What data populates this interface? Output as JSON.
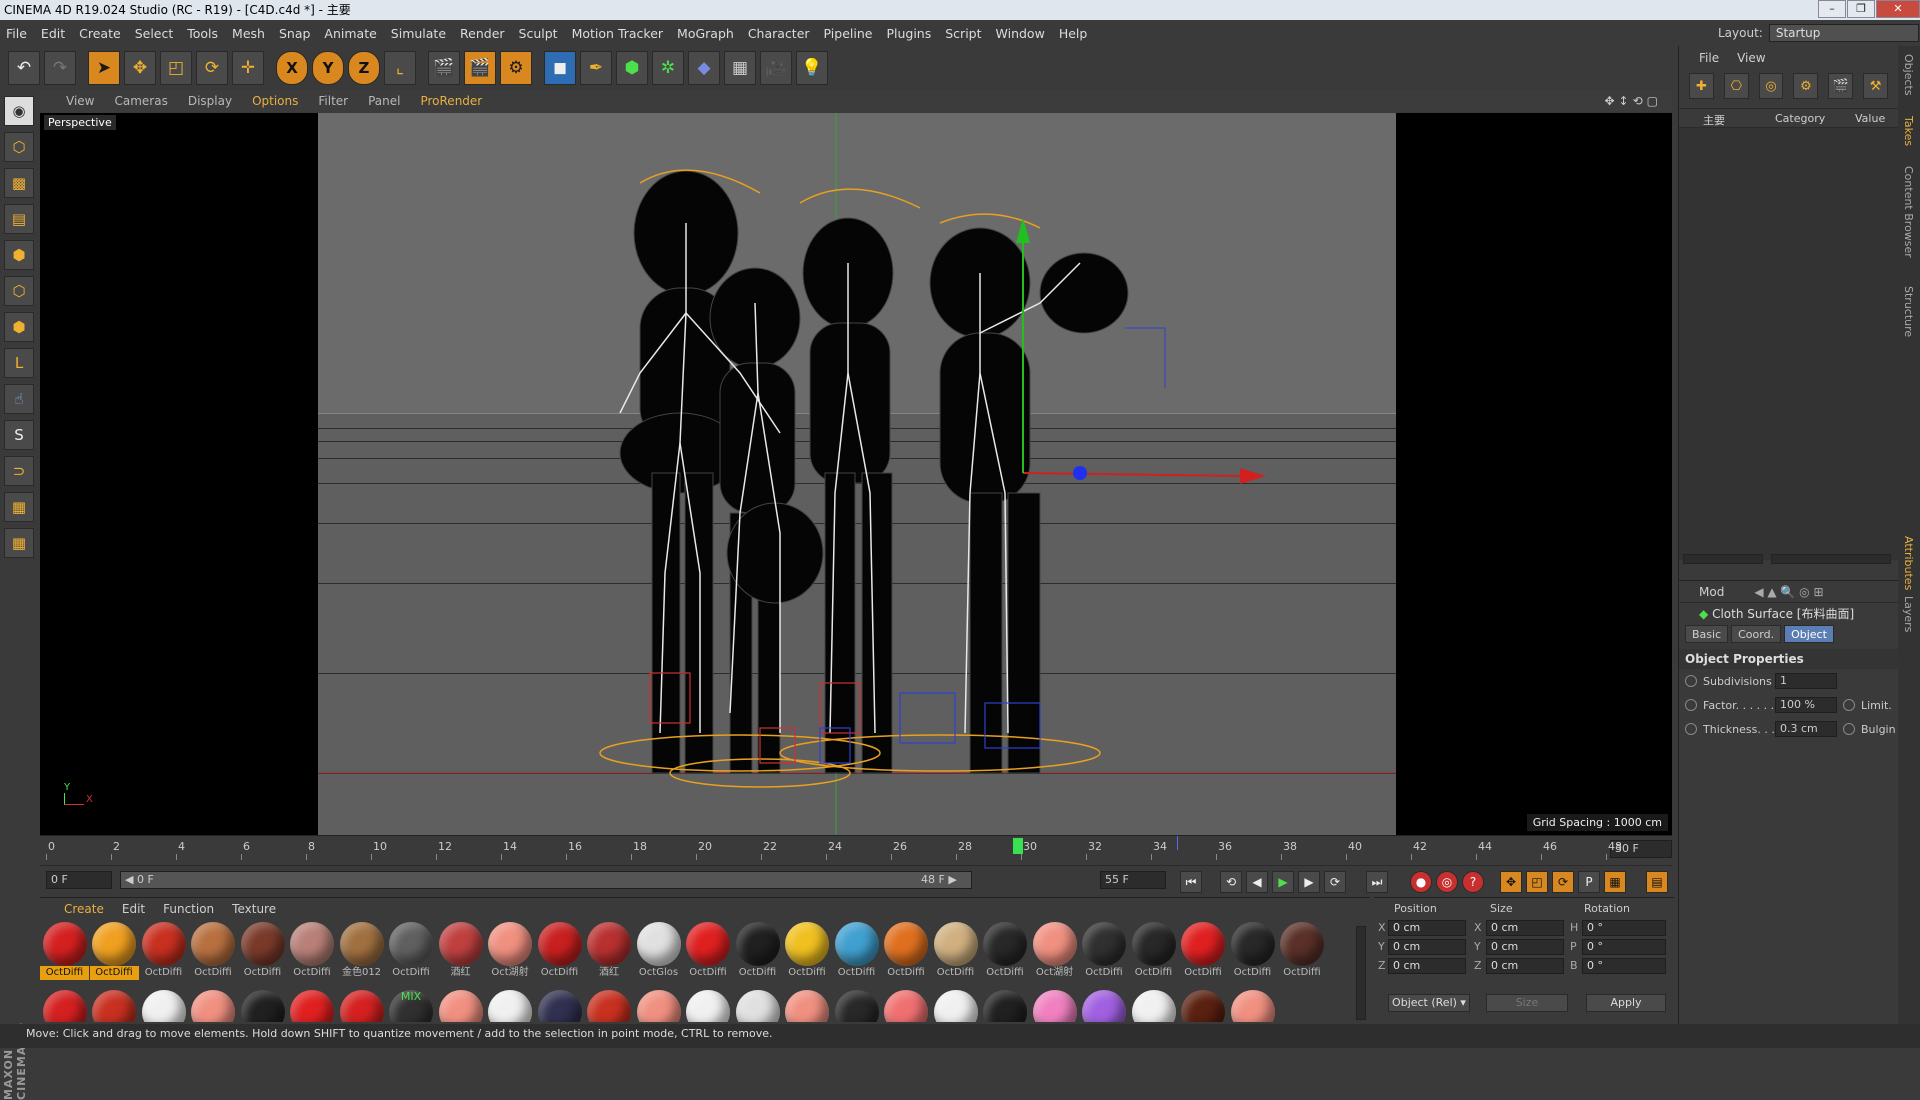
{
  "window": {
    "title": "CINEMA 4D R19.024 Studio (RC - R19) - [C4D.c4d *] - 主要",
    "controls": [
      "–",
      "❐",
      "✕"
    ]
  },
  "menu": [
    "File",
    "Edit",
    "Create",
    "Select",
    "Tools",
    "Mesh",
    "Snap",
    "Animate",
    "Simulate",
    "Render",
    "Sculpt",
    "Motion Tracker",
    "MoGraph",
    "Character",
    "Pipeline",
    "Plugins",
    "Script",
    "Window",
    "Help"
  ],
  "layout": {
    "label": "Layout:",
    "value": "Startup"
  },
  "viewport": {
    "menu": [
      "View",
      "Cameras",
      "Display",
      "Options",
      "Filter",
      "Panel",
      "ProRender"
    ],
    "label": "Perspective",
    "grid_spacing": "Grid Spacing : 1000 cm",
    "axis_y": "Y",
    "axis_x": "X"
  },
  "timeline": {
    "ticks": [
      "0",
      "2",
      "4",
      "6",
      "8",
      "10",
      "12",
      "14",
      "16",
      "18",
      "20",
      "22",
      "24",
      "26",
      "28",
      "30",
      "32",
      "34",
      "36",
      "38",
      "40",
      "42",
      "44",
      "46",
      "48"
    ],
    "current_frame_field": "30 F",
    "start_field": "0 F",
    "range_start": "◀ 0 F",
    "range_end": "48 F ▶",
    "end_field": "55 F"
  },
  "materials": {
    "tabs": [
      "Create",
      "Edit",
      "Function",
      "Texture"
    ],
    "row1": [
      {
        "name": "OctDiffi",
        "color": "#d42020",
        "sel": true
      },
      {
        "name": "OctDiffi",
        "color": "#f0a020",
        "sel": true
      },
      {
        "name": "OctDiffi",
        "color": "#c83020",
        "sel": false
      },
      {
        "name": "OctDiffi",
        "color": "#b87040",
        "sel": false
      },
      {
        "name": "OctDiffi",
        "color": "#7a3a2a",
        "sel": false
      },
      {
        "name": "OctDiffi",
        "color": "#b88078",
        "sel": false
      },
      {
        "name": "金色012",
        "color": "#a07040",
        "sel": false
      },
      {
        "name": "OctDiffi",
        "color": "#606060",
        "sel": false
      },
      {
        "name": "酒红",
        "color": "#c04040",
        "sel": false
      },
      {
        "name": "Oct湖射",
        "color": "#f09080",
        "sel": false
      },
      {
        "name": "OctDiffi",
        "color": "#c82020",
        "sel": false
      },
      {
        "name": "酒红",
        "color": "#b83030",
        "sel": false
      },
      {
        "name": "OctGlos",
        "color": "#e0e0e0",
        "sel": false
      },
      {
        "name": "OctDiffi",
        "color": "#e02020",
        "sel": false
      },
      {
        "name": "OctDiffi",
        "color": "#202020",
        "sel": false
      },
      {
        "name": "OctDiffi",
        "color": "#f0c020",
        "sel": false
      },
      {
        "name": "OctDiffi",
        "color": "#40a0d0",
        "sel": false
      },
      {
        "name": "OctDiffi",
        "color": "#e07020",
        "sel": false
      },
      {
        "name": "OctDiffi",
        "color": "#d0b080",
        "sel": false
      },
      {
        "name": "OctDiffi",
        "color": "#282828",
        "sel": false
      },
      {
        "name": "Oct湖射",
        "color": "#f09080",
        "sel": false
      },
      {
        "name": "OctDiffi",
        "color": "#303030",
        "sel": false
      },
      {
        "name": "OctDiffi",
        "color": "#282828",
        "sel": false
      },
      {
        "name": "OctDiffi",
        "color": "#e02020",
        "sel": false
      },
      {
        "name": "OctDiffi",
        "color": "#282828",
        "sel": false
      },
      {
        "name": "OctDiffi",
        "color": "#5a3028",
        "sel": false
      }
    ],
    "row2_colors": [
      "#d42020",
      "#c83020",
      "#f0f0f0",
      "#f09080",
      "#202020",
      "#e02020",
      "#d42020",
      "#303030",
      "#f09080",
      "#f0f0f0",
      "#303050",
      "#c83020",
      "#f09080",
      "#f0f0f0",
      "#e0e0e0",
      "#f09080",
      "#282828",
      "#f07070",
      "#f0f0f0",
      "#202020",
      "#f080c0",
      "#a060e0",
      "#f0f0f0",
      "#5a2010",
      "#f09080"
    ],
    "mix_label": "MIX"
  },
  "coords": {
    "headers": [
      "Position",
      "Size",
      "Rotation"
    ],
    "rows": [
      {
        "a": "X",
        "p": "0 cm",
        "b": "X",
        "s": "0 cm",
        "c": "H",
        "r": "0 °"
      },
      {
        "a": "Y",
        "p": "0 cm",
        "b": "Y",
        "s": "0 cm",
        "c": "P",
        "r": "0 °"
      },
      {
        "a": "Z",
        "p": "0 cm",
        "b": "Z",
        "s": "0 cm",
        "c": "B",
        "r": "0 °"
      }
    ],
    "mode_select": "Object (Rel) ▾",
    "size_select": "Size",
    "apply": "Apply"
  },
  "objects_panel": {
    "menu": [
      "File",
      "View"
    ],
    "columns": [
      "主要",
      "Category",
      "Value"
    ]
  },
  "attributes": {
    "mode": "Mod",
    "object_name": "Cloth Surface [布料曲面]",
    "tabs": [
      "Basic",
      "Coord.",
      "Object"
    ],
    "section": "Object Properties",
    "props": [
      {
        "label": "Subdivisions",
        "value": "1",
        "extra": ""
      },
      {
        "label": "Factor. . . . . .",
        "value": "100 %",
        "extra": "Limit."
      },
      {
        "label": "Thickness. . .",
        "value": "0.3 cm",
        "extra": "Bulgin"
      }
    ]
  },
  "right_tabs": [
    "Objects",
    "Takes",
    "Content Browser",
    "Structure"
  ],
  "right_tabs_lower": [
    "Attributes",
    "Layers"
  ],
  "status": "Move: Click and drag to move elements. Hold down SHIFT to quantize movement / add to the selection in point mode, CTRL to remove.",
  "brand": "MAXON CINEMA 4D"
}
